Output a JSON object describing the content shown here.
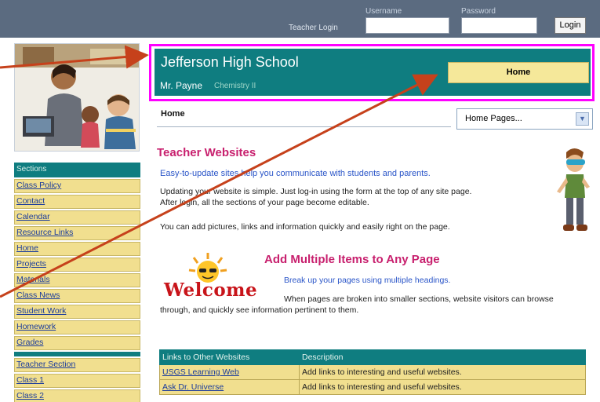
{
  "top_bar": {
    "teacher_login_label": "Teacher Login",
    "username_label": "Username",
    "password_label": "Password",
    "login_button": "Login"
  },
  "header": {
    "school_name": "Jefferson High School",
    "teacher_name": "Mr. Payne",
    "class_name": "Chemistry II",
    "home_button": "Home"
  },
  "breadcrumb": "Home",
  "pages_dropdown": {
    "selected": "Home Pages..."
  },
  "sidebar": {
    "sections_header": "Sections",
    "items": [
      "Class Policy",
      "Contact",
      "Calendar",
      "Resource Links",
      "Home",
      "Projects",
      "Materials",
      "Class News",
      "Student Work",
      "Homework",
      "Grades"
    ],
    "teacher_items": [
      "Teacher Section",
      "Class 1",
      "Class 2"
    ]
  },
  "teacher_websites": {
    "heading": "Teacher Websites",
    "tagline": "Easy-to-update sites help you communicate with students and parents.",
    "paragraph1_line1": "Updating your website is simple. Just log-in using the form at the top of any site page.",
    "paragraph1_line2": "After login, all the sections of your page become editable.",
    "paragraph2": "You can add pictures, links and information quickly and easily right on the page."
  },
  "add_items": {
    "heading": "Add Multiple Items to Any Page",
    "tagline": "Break up your pages using multiple headings.",
    "paragraph_line1": "When pages are broken into smaller sections, website visitors can browse",
    "paragraph_line2": "through, and quickly see information pertinent to them.",
    "welcome_text": "Welcome"
  },
  "links_table": {
    "headers": [
      "Links to Other Websites",
      "Description"
    ],
    "rows": [
      [
        "USGS Learning Web",
        "Add links to interesting and useful websites."
      ],
      [
        "Ask Dr. Universe",
        "Add links to interesting and useful websites."
      ]
    ]
  },
  "colors": {
    "teal": "#0f7d80",
    "tan": "#f1df8f",
    "magenta_heading": "#c8206e",
    "highlight_frame": "#ff00ff",
    "arrow": "#c6411b"
  }
}
